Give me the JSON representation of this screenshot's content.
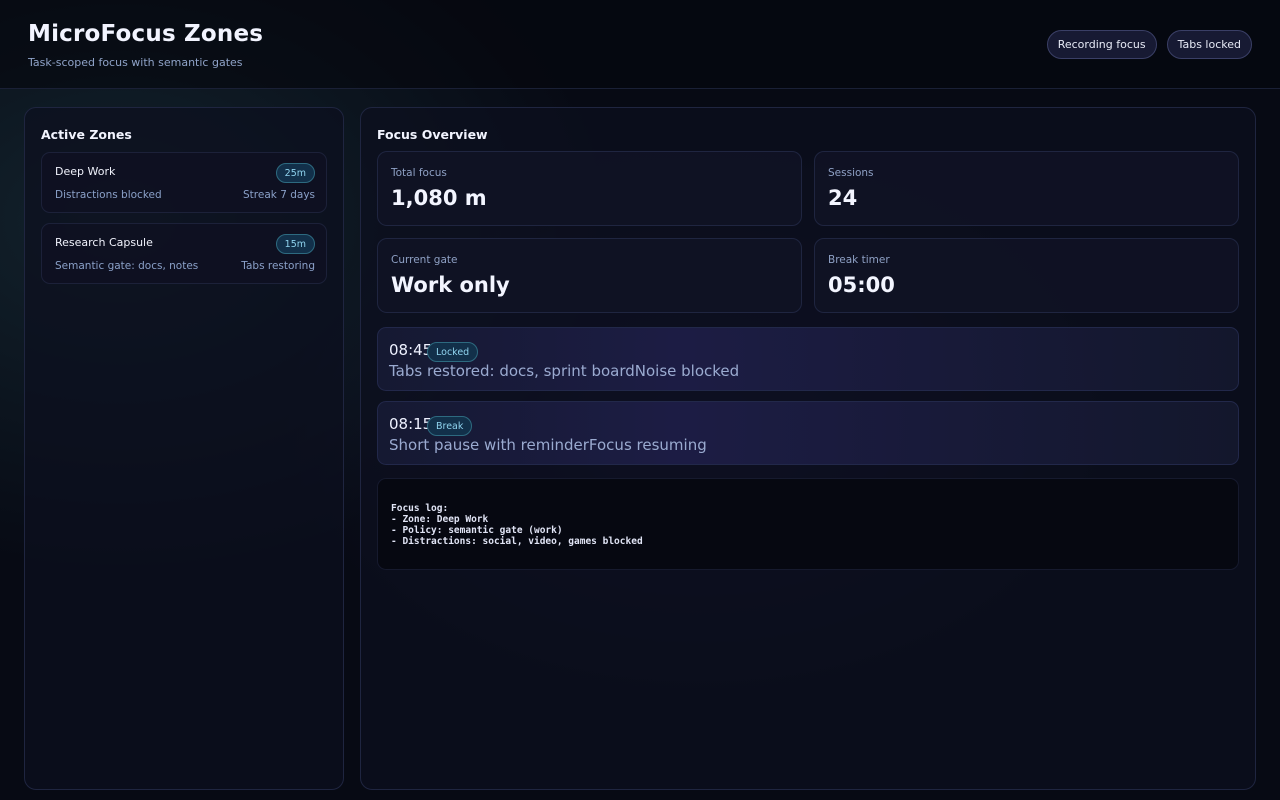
{
  "header": {
    "title": "MicroFocus Zones",
    "subtitle": "Task-scoped focus with semantic gates",
    "pills": [
      "Recording focus",
      "Tabs locked"
    ]
  },
  "zones": {
    "title": "Active Zones",
    "items": [
      {
        "name": "Deep Work",
        "badge": "25m",
        "desc": "Distractions blocked",
        "meta": "Streak 7 days"
      },
      {
        "name": "Research Capsule",
        "badge": "15m",
        "desc": "Semantic gate: docs, notes",
        "meta": "Tabs restoring"
      }
    ]
  },
  "overview": {
    "title": "Focus Overview",
    "stats": [
      {
        "label": "Total focus",
        "value": "1,080 m"
      },
      {
        "label": "Sessions",
        "value": "24"
      },
      {
        "label": "Current gate",
        "value": "Work only"
      },
      {
        "label": "Break timer",
        "value": "05:00"
      }
    ],
    "events": [
      {
        "time": "08:45",
        "tag": "Locked",
        "text": "Tabs restored: docs, sprint boardNoise blocked"
      },
      {
        "time": "08:15",
        "tag": "Break",
        "text": "Short pause with reminderFocus resuming"
      }
    ],
    "log": "Focus log:\n- Zone: Deep Work\n- Policy: semantic gate (work)\n- Distractions: social, video, games blocked"
  },
  "colors": {
    "background": "#070a14",
    "badge_accent": "#8fd3ee",
    "pill_border": "#3a3f66"
  }
}
